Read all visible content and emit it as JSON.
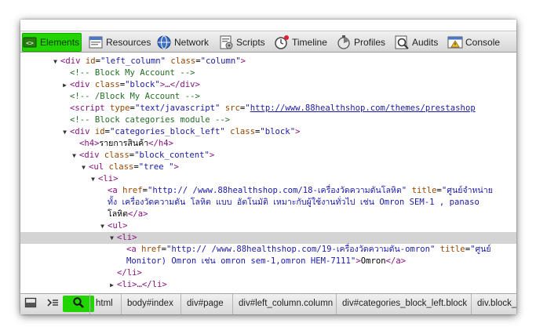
{
  "toolbar": {
    "tabs": [
      {
        "label": "Elements",
        "icon": "elements-icon",
        "selected": true
      },
      {
        "label": "Resources",
        "icon": "resources-icon"
      },
      {
        "label": "Network",
        "icon": "network-icon"
      },
      {
        "label": "Scripts",
        "icon": "scripts-icon"
      },
      {
        "label": "Timeline",
        "icon": "timeline-icon"
      },
      {
        "label": "Profiles",
        "icon": "profiles-icon"
      },
      {
        "label": "Audits",
        "icon": "audits-icon"
      },
      {
        "label": "Console",
        "icon": "console-icon"
      }
    ]
  },
  "dom": {
    "l1": {
      "tag": "<div ",
      "a1": "id",
      "v1": "\"left_column\"",
      "a2": "class",
      "v2": "\"column\"",
      "end": ">"
    },
    "l2": {
      "comment": "<!-- Block My Account -->"
    },
    "l3": {
      "tag": "<div ",
      "a1": "class",
      "v1": "\"block\"",
      "end": ">…</div>"
    },
    "l4": {
      "comment": "<!-- /Block My Account -->"
    },
    "l5": {
      "tag": "<script ",
      "a1": "type",
      "v1": "\"text/javascript\"",
      "a2": "src",
      "v2": "\"",
      "link": "http://www.88healthshop.com/themes/prestashop"
    },
    "l6": {
      "comment": "<!-- Block categories module -->"
    },
    "l7": {
      "tag": "<div ",
      "a1": "id",
      "v1": "\"categories_block_left\"",
      "a2": "class",
      "v2": "\"block\"",
      "end": ">"
    },
    "l8": {
      "tag": "<h4>",
      "text": "รายการสินค้า",
      "end": "</h4>"
    },
    "l9": {
      "tag": "<div ",
      "a1": "class",
      "v1": "\"block_content\"",
      "end": ">"
    },
    "l10": {
      "tag": "<ul ",
      "a1": "class",
      "v1": "\"tree \"",
      "end": ">"
    },
    "l11": {
      "tag": "<li>"
    },
    "l12": {
      "tag": "<a ",
      "a1": "href",
      "v1": "\"http:// /www.88healthshop.com/18-เครื่องวัดความดันโลหิต\"",
      "a2": "title",
      "v2": "\"ศูนย์จำหน่าย"
    },
    "l13": {
      "cont": "ทั้ง เครื่องวัดความดัน โลหิต แบบ อัตโนมัติ  เหมาะกับผู้ใช้งานทั่วไป เช่น Omron SEM-1 , panaso"
    },
    "l14": {
      "text": "โลหิต",
      "end": "</a>"
    },
    "l15": {
      "tag": "<ul>"
    },
    "l16": {
      "tag": "<li>"
    },
    "l17": {
      "tag": "<a ",
      "a1": "href",
      "v1": "\"http:// /www.88healthshop.com/19-เครื่องวัดความดัน-omron\"",
      "a2": "title",
      "v2": "\"ศูนย์"
    },
    "l18": {
      "cont": "Monitor)  Omron เช่น omron sem-1,omron HEM-7111\"",
      "end1": ">",
      "text": "Omron",
      "end2": "</a>"
    },
    "l19": {
      "tag": "</li>"
    },
    "l20": {
      "tag": "<li>",
      "end": "…</li>"
    }
  },
  "statusbar": {
    "dock_icon": "dock-icon",
    "console_icon": "console-toggle-icon",
    "search_icon": "search-icon",
    "breadcrumbs": [
      "html",
      "body#index",
      "div#page",
      "div#left_column.column",
      "div#categories_block_left.block",
      "div.block_"
    ]
  }
}
